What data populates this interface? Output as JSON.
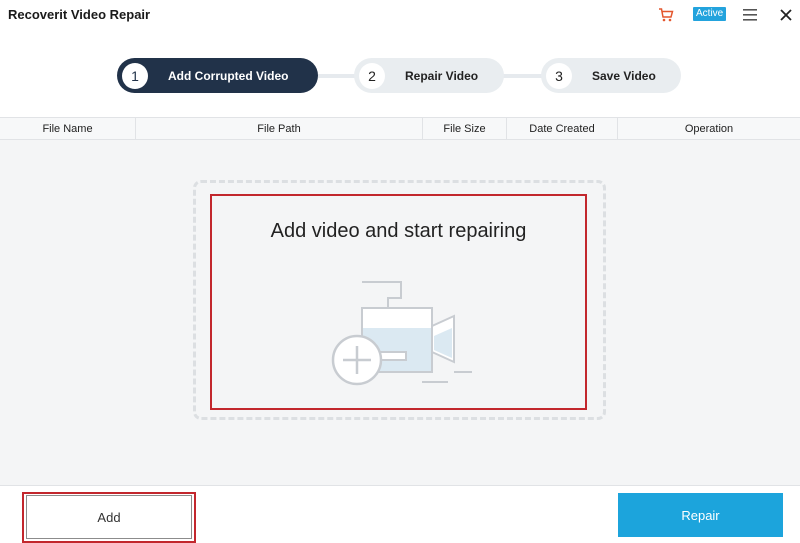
{
  "app": {
    "title": "Recoverit Video Repair",
    "active_badge": "Active",
    "icons": [
      "cart-icon",
      "menu-icon",
      "close-icon"
    ]
  },
  "steps": [
    {
      "number": "1",
      "label": "Add Corrupted Video",
      "state": "active"
    },
    {
      "number": "2",
      "label": "Repair Video",
      "state": "inactive"
    },
    {
      "number": "3",
      "label": "Save Video",
      "state": "inactive"
    }
  ],
  "table": {
    "columns": [
      "File Name",
      "File Path",
      "File Size",
      "Date Created",
      "Operation"
    ]
  },
  "dropzone": {
    "text": "Add video and start repairing",
    "icon": "camera-add-icon"
  },
  "footer": {
    "add_label": "Add",
    "repair_label": "Repair"
  },
  "colors": {
    "accent": "#1ca4dc",
    "active_step": "#213249",
    "highlight": "#c2272d",
    "cart": "#e4572e"
  }
}
